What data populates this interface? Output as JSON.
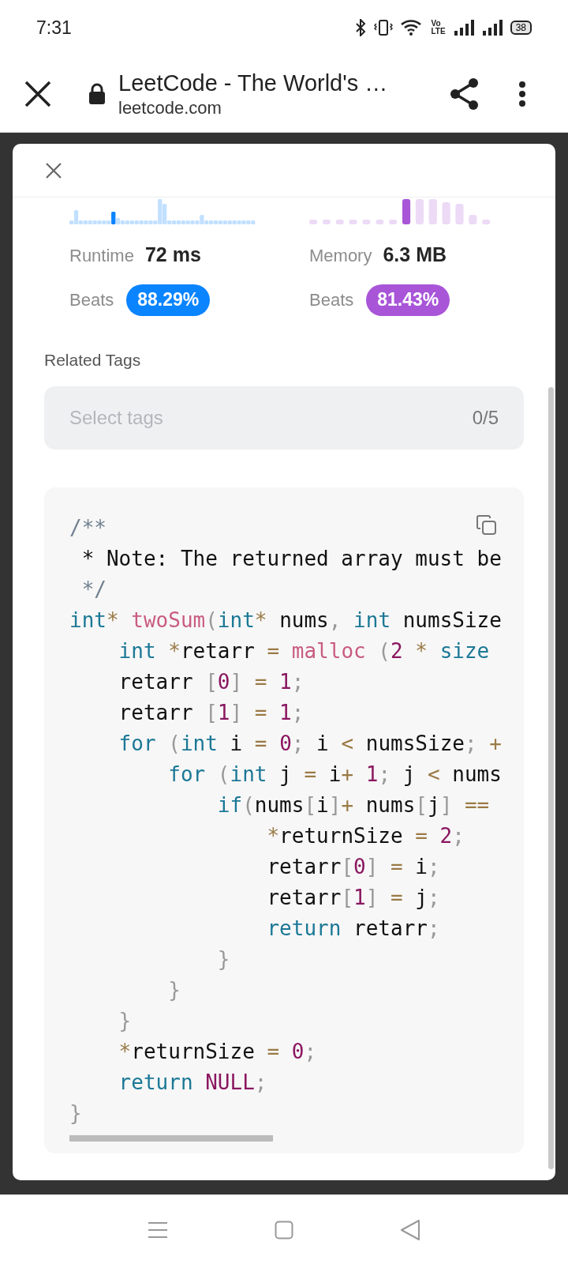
{
  "status_bar": {
    "time": "7:31",
    "volte": [
      "Vo",
      "LTE"
    ],
    "battery": "38"
  },
  "browser_bar": {
    "title": "LeetCode - The World's …",
    "url": "leetcode.com"
  },
  "stats": [
    {
      "label": "Runtime",
      "value": "72 ms",
      "beats_label": "Beats",
      "beats": "88.29%",
      "color": "#0a84ff"
    },
    {
      "label": "Memory",
      "value": "6.3 MB",
      "beats_label": "Beats",
      "beats": "81.43%",
      "color": "#a855d8"
    }
  ],
  "related_tags": {
    "title": "Related Tags",
    "placeholder": "Select tags",
    "count": "0/5"
  },
  "code": {
    "lines": [
      [
        {
          "kind": "cm",
          "text": "/**"
        }
      ],
      [
        {
          "kind": "pl",
          "text": " * Note: The returned array must be"
        }
      ],
      [
        {
          "kind": "cm",
          "text": " */"
        }
      ],
      [
        {
          "kind": "kw",
          "text": "int"
        },
        {
          "kind": "op",
          "text": "*"
        },
        {
          "kind": "fn",
          "text": " twoSum"
        },
        {
          "kind": "pu",
          "text": "("
        },
        {
          "kind": "kw",
          "text": "int"
        },
        {
          "kind": "op",
          "text": "*"
        },
        {
          "kind": "pl",
          "text": " nums"
        },
        {
          "kind": "pu",
          "text": ","
        },
        {
          "kind": "kw",
          "text": " int"
        },
        {
          "kind": "pl",
          "text": " numsSize"
        }
      ],
      [
        {
          "kind": "kw",
          "text": "    int"
        },
        {
          "kind": "op",
          "text": " *"
        },
        {
          "kind": "pl",
          "text": "retarr "
        },
        {
          "kind": "op",
          "text": "="
        },
        {
          "kind": "fn",
          "text": " malloc"
        },
        {
          "kind": "pu",
          "text": " ("
        },
        {
          "kind": "nu",
          "text": "2"
        },
        {
          "kind": "op",
          "text": " *"
        },
        {
          "kind": "kw",
          "text": " size"
        }
      ],
      [
        {
          "kind": "pl",
          "text": "    retarr "
        },
        {
          "kind": "pu",
          "text": "["
        },
        {
          "kind": "nu",
          "text": "0"
        },
        {
          "kind": "pu",
          "text": "]"
        },
        {
          "kind": "op",
          "text": " ="
        },
        {
          "kind": "nu",
          "text": " 1"
        },
        {
          "kind": "pu",
          "text": ";"
        }
      ],
      [
        {
          "kind": "pl",
          "text": "    retarr "
        },
        {
          "kind": "pu",
          "text": "["
        },
        {
          "kind": "nu",
          "text": "1"
        },
        {
          "kind": "pu",
          "text": "]"
        },
        {
          "kind": "op",
          "text": " ="
        },
        {
          "kind": "nu",
          "text": " 1"
        },
        {
          "kind": "pu",
          "text": ";"
        }
      ],
      [
        {
          "kind": "kw",
          "text": "    for"
        },
        {
          "kind": "pu",
          "text": " ("
        },
        {
          "kind": "kw",
          "text": "int"
        },
        {
          "kind": "pl",
          "text": " i "
        },
        {
          "kind": "op",
          "text": "="
        },
        {
          "kind": "nu",
          "text": " 0"
        },
        {
          "kind": "pu",
          "text": ";"
        },
        {
          "kind": "pl",
          "text": " i "
        },
        {
          "kind": "op",
          "text": "<"
        },
        {
          "kind": "pl",
          "text": " numsSize"
        },
        {
          "kind": "pu",
          "text": ";"
        },
        {
          "kind": "op",
          "text": " +"
        }
      ],
      [
        {
          "kind": "kw",
          "text": "        for"
        },
        {
          "kind": "pu",
          "text": " ("
        },
        {
          "kind": "kw",
          "text": "int"
        },
        {
          "kind": "pl",
          "text": " j "
        },
        {
          "kind": "op",
          "text": "="
        },
        {
          "kind": "pl",
          "text": " i"
        },
        {
          "kind": "op",
          "text": "+"
        },
        {
          "kind": "nu",
          "text": " 1"
        },
        {
          "kind": "pu",
          "text": ";"
        },
        {
          "kind": "pl",
          "text": " j "
        },
        {
          "kind": "op",
          "text": "<"
        },
        {
          "kind": "pl",
          "text": " nums"
        }
      ],
      [
        {
          "kind": "kw",
          "text": "            if"
        },
        {
          "kind": "pu",
          "text": "("
        },
        {
          "kind": "pl",
          "text": "nums"
        },
        {
          "kind": "pu",
          "text": "["
        },
        {
          "kind": "pl",
          "text": "i"
        },
        {
          "kind": "pu",
          "text": "]"
        },
        {
          "kind": "op",
          "text": "+"
        },
        {
          "kind": "pl",
          "text": " nums"
        },
        {
          "kind": "pu",
          "text": "["
        },
        {
          "kind": "pl",
          "text": "j"
        },
        {
          "kind": "pu",
          "text": "]"
        },
        {
          "kind": "op",
          "text": " =="
        }
      ],
      [
        {
          "kind": "op",
          "text": "                *"
        },
        {
          "kind": "pl",
          "text": "returnSize "
        },
        {
          "kind": "op",
          "text": "="
        },
        {
          "kind": "nu",
          "text": " 2"
        },
        {
          "kind": "pu",
          "text": ";"
        }
      ],
      [
        {
          "kind": "pl",
          "text": "                retarr"
        },
        {
          "kind": "pu",
          "text": "["
        },
        {
          "kind": "nu",
          "text": "0"
        },
        {
          "kind": "pu",
          "text": "]"
        },
        {
          "kind": "op",
          "text": " ="
        },
        {
          "kind": "pl",
          "text": " i"
        },
        {
          "kind": "pu",
          "text": ";"
        }
      ],
      [
        {
          "kind": "pl",
          "text": "                retarr"
        },
        {
          "kind": "pu",
          "text": "["
        },
        {
          "kind": "nu",
          "text": "1"
        },
        {
          "kind": "pu",
          "text": "]"
        },
        {
          "kind": "op",
          "text": " ="
        },
        {
          "kind": "pl",
          "text": " j"
        },
        {
          "kind": "pu",
          "text": ";"
        }
      ],
      [
        {
          "kind": "kw",
          "text": "                return"
        },
        {
          "kind": "pl",
          "text": " retarr"
        },
        {
          "kind": "pu",
          "text": ";"
        }
      ],
      [
        {
          "kind": "pu",
          "text": "            }"
        }
      ],
      [
        {
          "kind": "pu",
          "text": "        }"
        }
      ],
      [
        {
          "kind": "pu",
          "text": "    }"
        }
      ],
      [
        {
          "kind": "op",
          "text": "    *"
        },
        {
          "kind": "pl",
          "text": "returnSize "
        },
        {
          "kind": "op",
          "text": "="
        },
        {
          "kind": "nu",
          "text": " 0"
        },
        {
          "kind": "pu",
          "text": ";"
        }
      ],
      [
        {
          "kind": "kw",
          "text": "    return"
        },
        {
          "kind": "nu",
          "text": " NULL"
        },
        {
          "kind": "pu",
          "text": ";"
        }
      ],
      [
        {
          "kind": "pu",
          "text": "}"
        }
      ]
    ]
  }
}
